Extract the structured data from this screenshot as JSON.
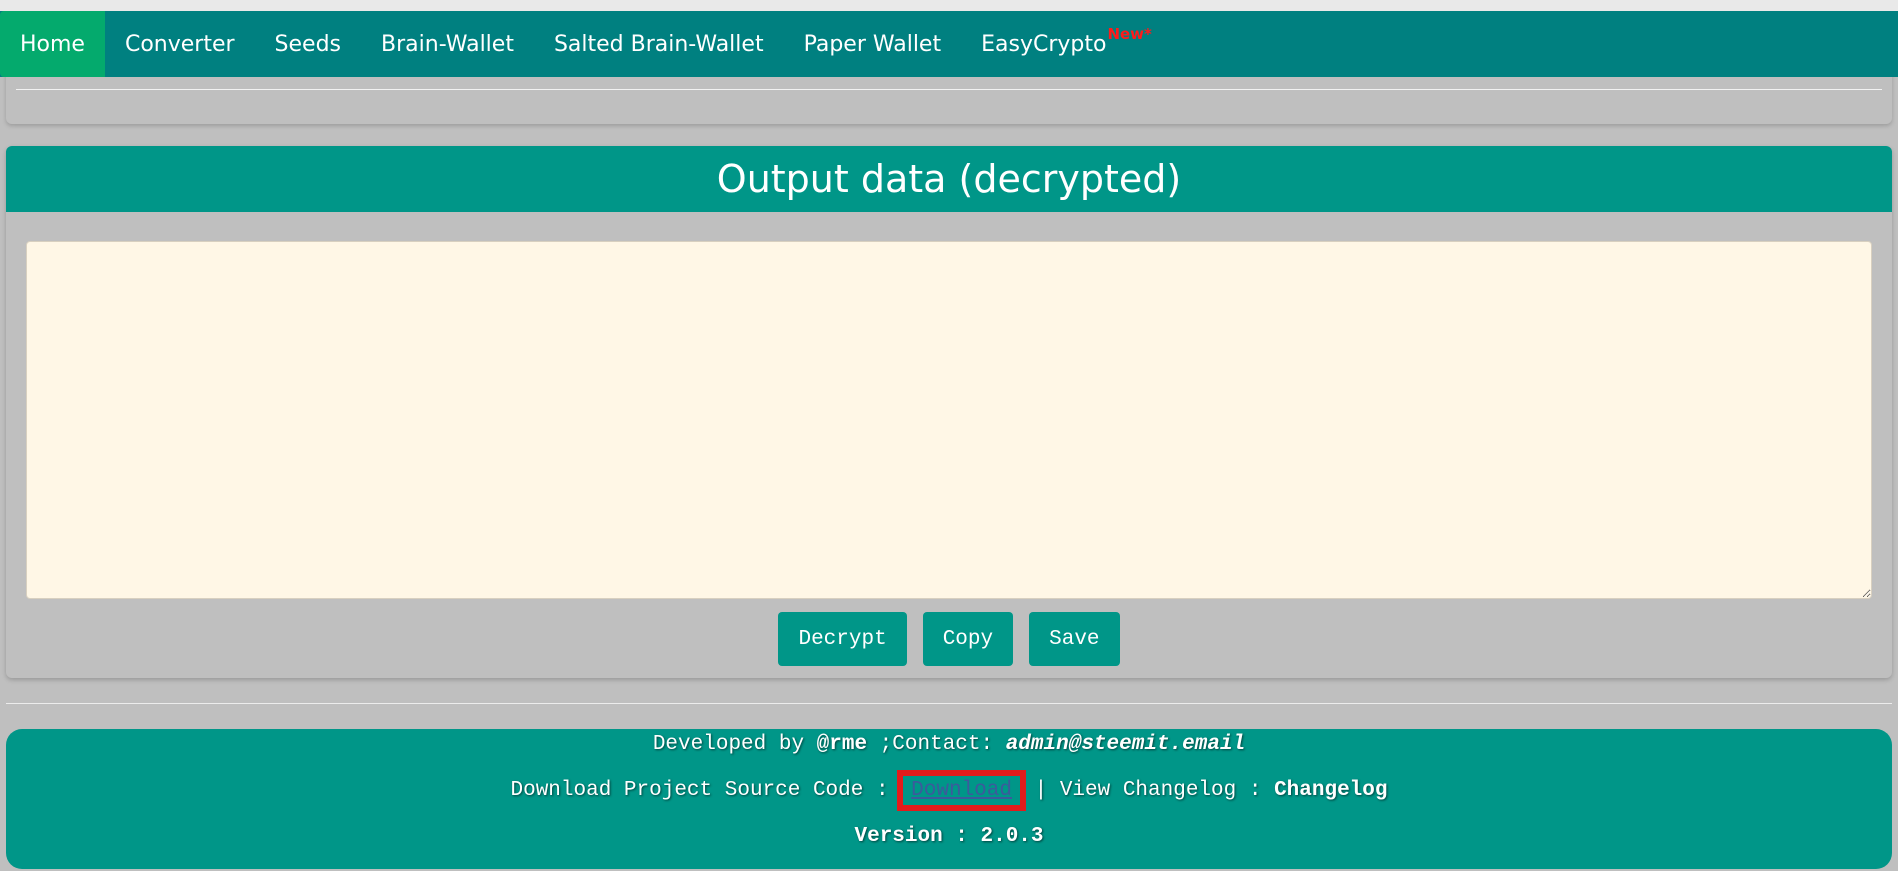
{
  "nav": {
    "items": [
      {
        "label": "Home",
        "active": true
      },
      {
        "label": "Converter"
      },
      {
        "label": "Seeds"
      },
      {
        "label": "Brain-Wallet"
      },
      {
        "label": "Salted Brain-Wallet"
      },
      {
        "label": "Paper Wallet"
      },
      {
        "label": "EasyCrypto",
        "badge": "New*"
      }
    ]
  },
  "output": {
    "title": "Output data (decrypted)",
    "value": ""
  },
  "buttons": {
    "decrypt": "Decrypt",
    "copy": "Copy",
    "save": "Save"
  },
  "footer": {
    "developed_prefix": "Developed by ",
    "developer": "@rme",
    "contact_prefix": " ;Contact: ",
    "contact_email": "admin@steemit.email",
    "download_prefix": "Download Project Source Code : ",
    "download_link": "Download",
    "separator": " | ",
    "changelog_prefix": "View Changelog : ",
    "changelog_link": "Changelog",
    "version": "Version : 2.0.3"
  },
  "colors": {
    "navbar": "#008080",
    "nav_active": "#04aa6d",
    "accent": "#009688",
    "page_bg": "#bfbfbf",
    "textarea_bg": "#fff7e6",
    "highlight_box": "#e41b1b",
    "badge": "#ff1a1a"
  }
}
